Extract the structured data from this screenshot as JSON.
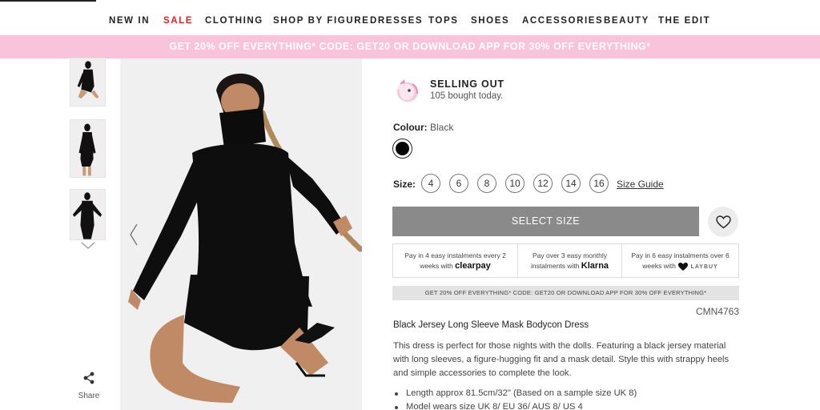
{
  "nav": {
    "items": [
      "NEW IN",
      "SALE",
      "CLOTHING",
      "SHOP BY FIGURE",
      "DRESSES",
      "TOPS",
      "SHOES",
      "ACCESSORIES",
      "BEAUTY",
      "THE EDIT"
    ]
  },
  "promo_banner": "GET 20% OFF EVERYTHING* CODE: GET20 OR DOWNLOAD APP FOR 30% OFF EVERYTHING*",
  "gallery": {
    "share_label": "Share"
  },
  "selling": {
    "title": "SELLING OUT",
    "subtitle": "105 bought today."
  },
  "colour": {
    "label": "Colour:",
    "value": "Black",
    "swatch_hex": "#000000"
  },
  "size": {
    "label": "Size:",
    "options": [
      "4",
      "6",
      "8",
      "10",
      "12",
      "14",
      "16"
    ],
    "guide_label": "Size Guide"
  },
  "select_button": "SELECT SIZE",
  "payments": [
    {
      "line1": "Pay in 4 easy instalments every 2",
      "line2": "weeks with",
      "brand": "clearpay"
    },
    {
      "line1": "Pay over 3 easy monthly",
      "line2": "instalments with",
      "brand": "Klarna"
    },
    {
      "line1": "Pay in 6 easy instalments over 6",
      "line2": "weeks with",
      "brand": "LAYBUY"
    }
  ],
  "promo_small": "GET 20% OFF EVERYTHING* CODE: GET20 OR DOWNLOAD APP FOR 30% OFF EVERYTHING*",
  "product": {
    "sku": "CMN4763",
    "title": "Black Jersey Long Sleeve Mask Bodycon Dress",
    "description": "This dress is perfect for those nights with the dolls. Featuring a black jersey material with long sleeves, a figure-hugging fit and a mask detail. Style this with strappy heels and simple accessories to complete the look.",
    "bullets": [
      "Length approx 81.5cm/32\" (Based on a sample size UK 8)",
      "Model wears size UK 8/ EU 36/ AUS 8/ US 4"
    ]
  },
  "colors": {
    "promo_bg": "#f9c3db",
    "sale": "#e02020",
    "select_button_bg": "#8a8a8a"
  }
}
